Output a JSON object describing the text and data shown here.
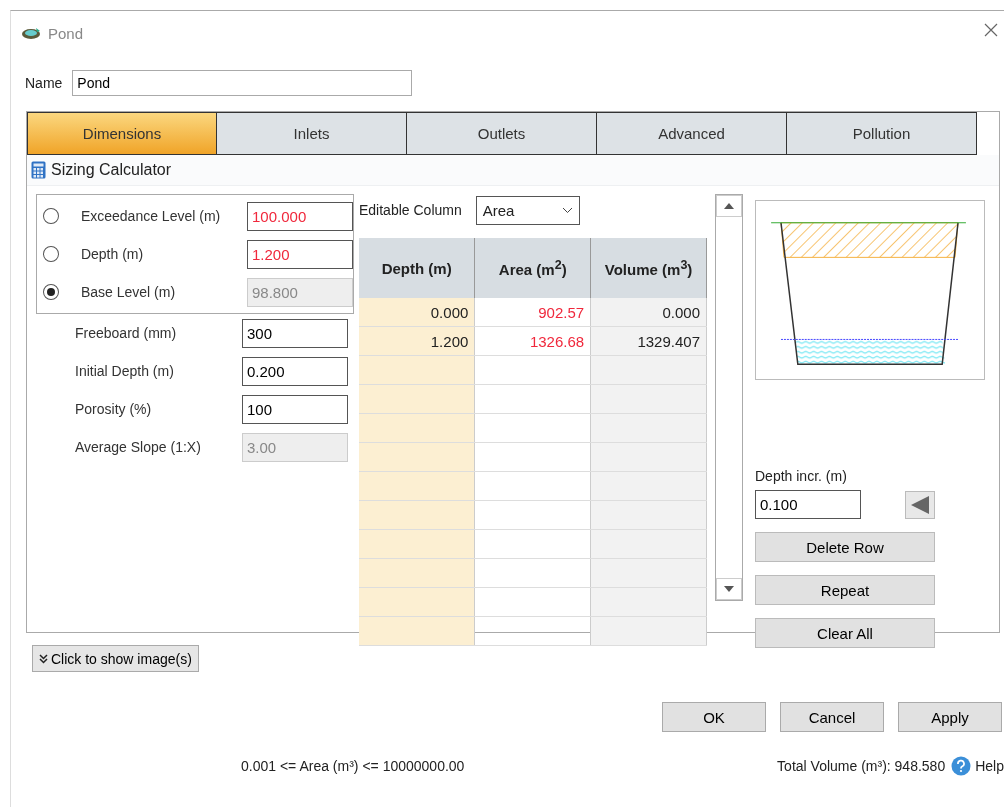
{
  "window": {
    "title": "Pond"
  },
  "name_field": {
    "label": "Name",
    "value": "Pond"
  },
  "tabs": [
    {
      "label": "Dimensions",
      "selected": true
    },
    {
      "label": "Inlets",
      "selected": false
    },
    {
      "label": "Outlets",
      "selected": false
    },
    {
      "label": "Advanced",
      "selected": false
    },
    {
      "label": "Pollution",
      "selected": false
    }
  ],
  "section_title": "Sizing Calculator",
  "radio_fields": [
    {
      "label": "Exceedance Level (m)",
      "value": "100.000",
      "selected": false,
      "warning": true,
      "disabled": false
    },
    {
      "label": "Depth (m)",
      "value": "1.200",
      "selected": false,
      "warning": true,
      "disabled": false
    },
    {
      "label": "Base Level (m)",
      "value": "98.800",
      "selected": true,
      "warning": false,
      "disabled": true
    }
  ],
  "fields": [
    {
      "label": "Freeboard (mm)",
      "value": "300",
      "disabled": false
    },
    {
      "label": "Initial Depth (m)",
      "value": "0.200",
      "disabled": false
    },
    {
      "label": "Porosity (%)",
      "value": "100",
      "disabled": false
    },
    {
      "label": "Average Slope (1:X)",
      "value": "3.00",
      "disabled": true
    }
  ],
  "editable_column": {
    "label": "Editable Column",
    "value": "Area"
  },
  "table": {
    "columns": [
      "Depth (m)",
      "Area (m$^{2}$)",
      "Volume (m$^{3}$)"
    ],
    "rows": [
      {
        "cells": [
          "0.000",
          "902.57",
          "0.000"
        ],
        "warning": [
          false,
          true,
          false
        ]
      },
      {
        "cells": [
          "1.200",
          "1326.68",
          "1329.407"
        ],
        "warning": [
          false,
          true,
          false
        ]
      }
    ]
  },
  "depth_increment": {
    "label": "Depth incr. (m)",
    "value": "0.100"
  },
  "side_buttons": [
    "Delete Row",
    "Repeat",
    "Clear All"
  ],
  "show_images_button": "Click to show image(s)",
  "dialog_buttons": [
    "OK",
    "Cancel",
    "Apply"
  ],
  "status_bar": {
    "range": "0.001 <= Area (m³) <= 10000000.00",
    "total": "Total Volume (m³): 948.580",
    "help": "Help"
  }
}
